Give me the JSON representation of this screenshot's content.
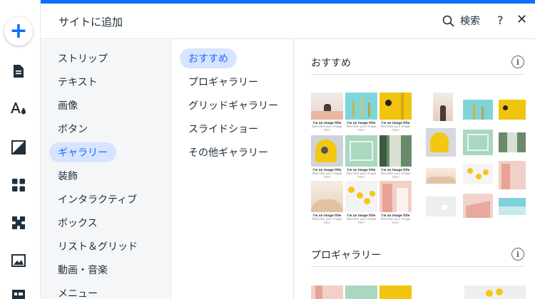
{
  "header": {
    "title": "サイトに追加",
    "search_label": "検索",
    "help_label": "?",
    "close_label": "✕"
  },
  "left_rail": {
    "add_label": "+",
    "icons": [
      "page-icon",
      "theme-icon",
      "background-icon",
      "apps-icon",
      "plugins-icon",
      "media-icon",
      "layout-icon"
    ]
  },
  "categories": [
    {
      "label": "ストリップ",
      "selected": false
    },
    {
      "label": "テキスト",
      "selected": false
    },
    {
      "label": "画像",
      "selected": false
    },
    {
      "label": "ボタン",
      "selected": false
    },
    {
      "label": "ギャラリー",
      "selected": true
    },
    {
      "label": "装飾",
      "selected": false
    },
    {
      "label": "インタラクティブ",
      "selected": false
    },
    {
      "label": "ボックス",
      "selected": false
    },
    {
      "label": "リスト＆グリッド",
      "selected": false
    },
    {
      "label": "動画・音楽",
      "selected": false
    },
    {
      "label": "メニュー",
      "selected": false
    }
  ],
  "subcategories": [
    {
      "label": "おすすめ",
      "selected": true
    },
    {
      "label": "プロギャラリー",
      "selected": false
    },
    {
      "label": "グリッドギャラリー",
      "selected": false
    },
    {
      "label": "スライドショー",
      "selected": false
    },
    {
      "label": "その他ギャラリー",
      "selected": false
    }
  ],
  "sections": [
    {
      "title": "おすすめ",
      "info": "i"
    },
    {
      "title": "プロギャラリー",
      "info": "i"
    }
  ],
  "gallery_caption": {
    "title": "I'm an image title",
    "subtitle": "Describe your image here"
  },
  "colors": {
    "accent": "#116dff",
    "selected_bg": "#d6e4ff",
    "sidebar_bg": "#f4f6f8"
  }
}
